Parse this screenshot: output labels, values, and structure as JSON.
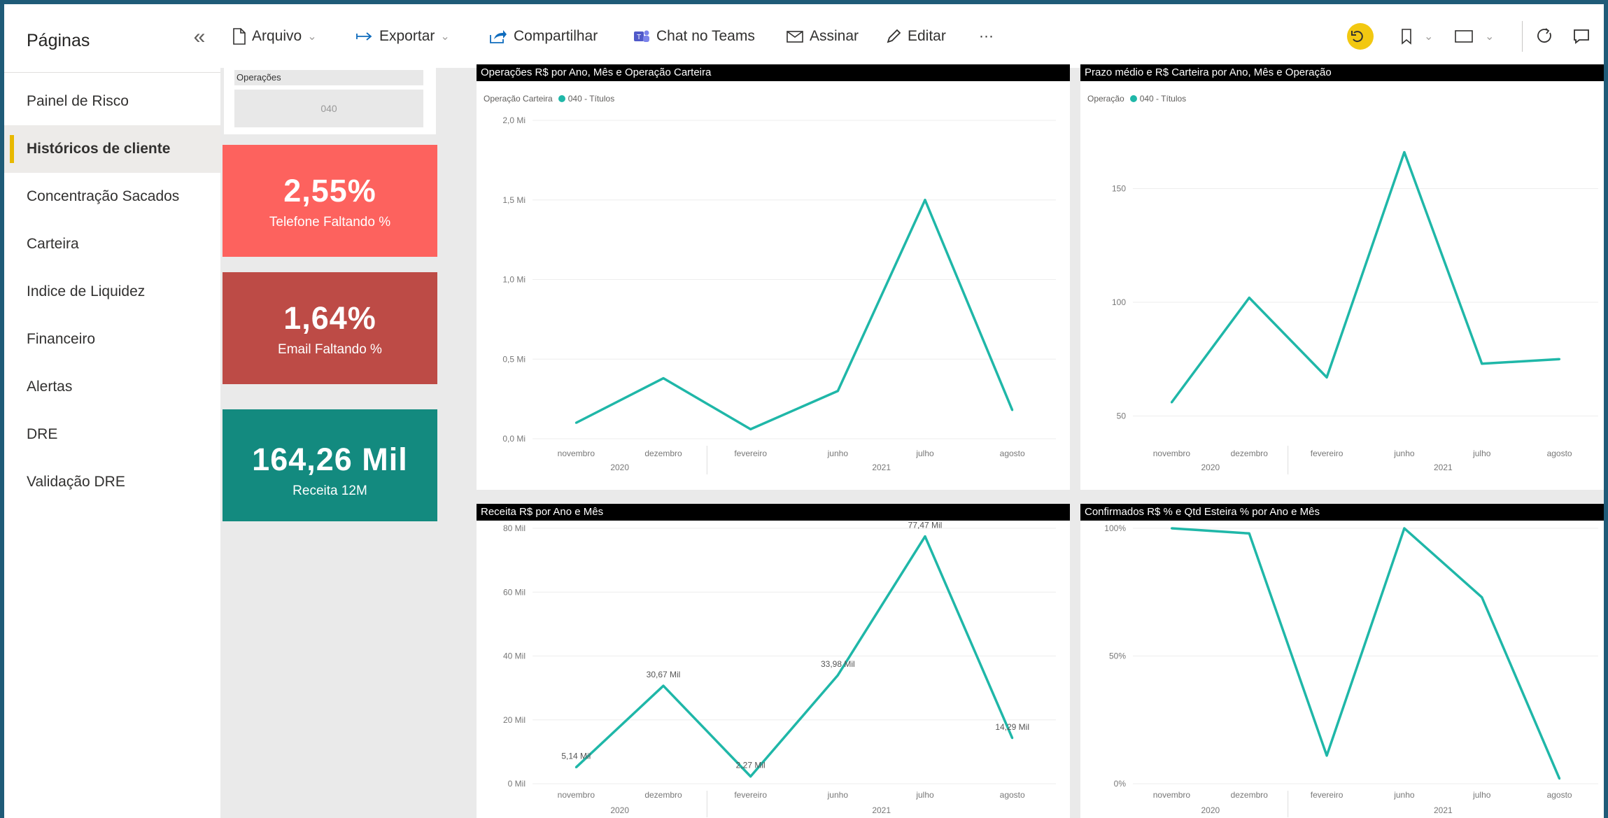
{
  "sidebar": {
    "title": "Páginas",
    "collapse_icon": "«",
    "items": [
      {
        "label": "Painel de Risco",
        "active": false
      },
      {
        "label": "Históricos de cliente",
        "active": true
      },
      {
        "label": "Concentração Sacados",
        "active": false
      },
      {
        "label": "Carteira",
        "active": false
      },
      {
        "label": "Indice de Liquidez",
        "active": false
      },
      {
        "label": "Financeiro",
        "active": false
      },
      {
        "label": "Alertas",
        "active": false
      },
      {
        "label": "DRE",
        "active": false
      },
      {
        "label": "Validação DRE",
        "active": false
      }
    ]
  },
  "toolbar": {
    "arquivo": "Arquivo",
    "exportar": "Exportar",
    "compartilhar": "Compartilhar",
    "chat_teams": "Chat no Teams",
    "assinar": "Assinar",
    "editar": "Editar",
    "more": "···",
    "icons": [
      "file-icon",
      "export-icon",
      "share-icon",
      "teams-icon",
      "mail-icon",
      "pencil-icon",
      "more-icon",
      "undo-icon",
      "bookmark-icon",
      "view-icon",
      "refresh-icon",
      "comment-icon"
    ],
    "accent": "#f2c811"
  },
  "slicer": {
    "title": "Operações",
    "value": "040"
  },
  "kpis": [
    {
      "value": "2,55%",
      "label": "Telefone Faltando %",
      "color": "#fd625e"
    },
    {
      "value": "1,64%",
      "label": "Email Faltando %",
      "color": "#bd4b46"
    },
    {
      "value": "164,26 Mil",
      "label": "Receita 12M",
      "color": "#138a7f"
    }
  ],
  "chart_data": [
    {
      "type": "line",
      "title": "Operações R$ por Ano, Mês e Operação Carteira",
      "legend_title": "Operação Carteira",
      "series": [
        {
          "name": "040 - Títulos",
          "color": "#1fb7a8",
          "values": [
            0.1,
            0.38,
            0.06,
            0.3,
            1.5,
            0.18
          ]
        }
      ],
      "categories": [
        "novembro",
        "dezembro",
        "fevereiro",
        "junho",
        "julho",
        "agosto"
      ],
      "year_groups": [
        {
          "label": "2020",
          "span": 2
        },
        {
          "label": "2021",
          "span": 4
        }
      ],
      "y_ticks": [
        "0,0 Mi",
        "0,5 Mi",
        "1,0 Mi",
        "1,5 Mi",
        "2,0 Mi"
      ],
      "ylim": [
        0,
        2
      ],
      "data_labels": []
    },
    {
      "type": "line",
      "title": "Prazo médio e R$ Carteira por Ano, Mês e Operação",
      "legend_title": "Operação",
      "series": [
        {
          "name": "040 - Títulos",
          "color": "#1fb7a8",
          "values": [
            56,
            102,
            67,
            166,
            73,
            75
          ]
        }
      ],
      "categories": [
        "novembro",
        "dezembro",
        "fevereiro",
        "junho",
        "julho",
        "agosto"
      ],
      "year_groups": [
        {
          "label": "2020",
          "span": 2
        },
        {
          "label": "2021",
          "span": 4
        }
      ],
      "y_ticks": [
        "50",
        "100",
        "150"
      ],
      "y_tick_values": [
        50,
        100,
        150
      ],
      "ylim": [
        40,
        180
      ],
      "data_labels": []
    },
    {
      "type": "line",
      "title": "Receita R$ por Ano e Mês",
      "legend_title": "",
      "series": [
        {
          "name": "",
          "color": "#1fb7a8",
          "values": [
            5.14,
            30.67,
            2.27,
            33.98,
            77.47,
            14.29
          ]
        }
      ],
      "categories": [
        "novembro",
        "dezembro",
        "fevereiro",
        "junho",
        "julho",
        "agosto"
      ],
      "year_groups": [
        {
          "label": "2020",
          "span": 2
        },
        {
          "label": "2021",
          "span": 4
        }
      ],
      "y_ticks": [
        "0 Mil",
        "20 Mil",
        "40 Mil",
        "60 Mil",
        "80 Mil"
      ],
      "ylim": [
        0,
        80
      ],
      "data_labels": [
        "5,14 Mil",
        "30,67 Mil",
        "2,27 Mil",
        "33,98 Mil",
        "77,47 Mil",
        "14,29 Mil"
      ]
    },
    {
      "type": "line",
      "title": "Confirmados R$ % e Qtd Esteira % por Ano e Mês",
      "legend_title": "",
      "series": [
        {
          "name": "",
          "color": "#1fb7a8",
          "values": [
            100,
            98,
            11,
            100,
            73,
            2
          ]
        }
      ],
      "categories": [
        "novembro",
        "dezembro",
        "fevereiro",
        "junho",
        "julho",
        "agosto"
      ],
      "year_groups": [
        {
          "label": "2020",
          "span": 2
        },
        {
          "label": "2021",
          "span": 4
        }
      ],
      "y_ticks": [
        "0%",
        "50%",
        "100%"
      ],
      "ylim": [
        0,
        100
      ],
      "data_labels": []
    }
  ]
}
